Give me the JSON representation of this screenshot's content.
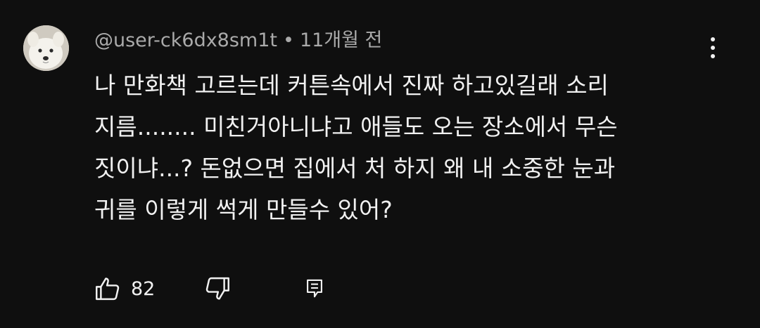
{
  "comment": {
    "author": "@user-ck6dx8sm1t",
    "separator": "•",
    "time": "11개월 전",
    "lines": [
      "나 만화책 고르는데 커튼속에서 진짜 하고있길래 소리",
      "지름........ 미친거아니냐고 애들도 오는 장소에서 무슨",
      "짓이냐...?  돈없으면 집에서 처 하지 왜 내 소중한 눈과",
      "귀를 이렇게 썩게 만들수 있어?"
    ],
    "like_count": "82"
  },
  "icons": {
    "avatar": "white-dog-avatar",
    "more": "more-vertical-icon",
    "like": "thumbs-up-icon",
    "dislike": "thumbs-down-icon",
    "reply": "reply-comment-icon"
  },
  "colors": {
    "background": "#0f0f0f",
    "primary_text": "#f1f1f1",
    "secondary_text": "#aaaaaa"
  }
}
